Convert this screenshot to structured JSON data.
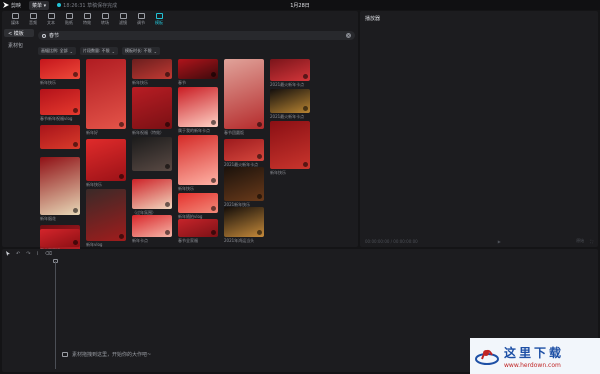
{
  "titlebar": {
    "app_name": "剪映",
    "menu_label": "菜单",
    "draft_info": "18:26:31 草稿保存完成",
    "project_title": "1月28日"
  },
  "toolbar": {
    "items": [
      {
        "label": "媒体",
        "icon": "media-icon"
      },
      {
        "label": "音频",
        "icon": "audio-icon"
      },
      {
        "label": "文本",
        "icon": "text-icon"
      },
      {
        "label": "贴纸",
        "icon": "sticker-icon"
      },
      {
        "label": "特效",
        "icon": "effects-icon"
      },
      {
        "label": "转场",
        "icon": "transition-icon"
      },
      {
        "label": "滤镜",
        "icon": "filter-icon"
      },
      {
        "label": "调节",
        "icon": "adjust-icon"
      },
      {
        "label": "模板",
        "icon": "template-icon"
      }
    ],
    "active_index": 8
  },
  "sidebar": {
    "items": [
      {
        "label": "< 模板"
      },
      {
        "label": "素材包"
      }
    ]
  },
  "search": {
    "value": "春节",
    "clear_icon": "clear-icon"
  },
  "filters": [
    {
      "label": "画幅比例: 全部"
    },
    {
      "label": "片段数量: 不限"
    },
    {
      "label": "模板时长: 不限"
    }
  ],
  "templates": [
    {
      "title": "新年快乐",
      "badge": "",
      "colors": [
        "#c4161c",
        "#f04a3a"
      ]
    },
    {
      "title": "春节新年祝福vlog",
      "badge": "",
      "colors": [
        "#b3121a",
        "#e63a2e"
      ]
    },
    {
      "title": "",
      "badge": "",
      "colors": [
        "#a8141a",
        "#d93b2b"
      ]
    },
    {
      "title": "新年烟花",
      "badge": "",
      "colors": [
        "#8f1015",
        "#e8d9b8"
      ]
    },
    {
      "title": "新年家人福",
      "badge": "",
      "colors": [
        "#6f0d12",
        "#c9232a"
      ]
    },
    {
      "title": "春节团圆饭",
      "badge": "",
      "colors": [
        "#d4252b",
        "#8c0f14"
      ]
    },
    {
      "title": "新年好",
      "badge": "",
      "colors": [
        "#b01c22",
        "#e45449"
      ]
    },
    {
      "title": "新年快乐",
      "badge": "",
      "colors": [
        "#e02b2b",
        "#9c1217"
      ]
    },
    {
      "title": "新年vlog",
      "badge": "",
      "colors": [
        "#3a2a28",
        "#a01c1c"
      ]
    },
    {
      "title": "新年快乐",
      "badge": "",
      "colors": [
        "#6b1e1e",
        "#c23a33"
      ]
    },
    {
      "title": "新年祝福（特效）",
      "badge": "",
      "colors": [
        "#b81d24",
        "#7a1014"
      ]
    },
    {
      "title": "",
      "badge": "",
      "colors": [
        "#1b1b1b",
        "#5a4a44"
      ]
    },
    {
      "title": "（过年氛围）",
      "badge": "",
      "colors": [
        "#cd2127",
        "#f2d8c0"
      ]
    },
    {
      "title": "新年卡点",
      "badge": "",
      "colors": [
        "#d9262a",
        "#f5b6a8"
      ]
    },
    {
      "title": "春节",
      "badge": "",
      "colors": [
        "#b0141b",
        "#3e0a0c"
      ]
    },
    {
      "title": "属于我的新年卡点",
      "badge": "",
      "colors": [
        "#c91c23",
        "#ffd2c6"
      ]
    },
    {
      "title": "新年快乐",
      "badge": "",
      "colors": [
        "#d42a27",
        "#ffb3a6"
      ]
    },
    {
      "title": "新年随拍vlog",
      "badge": "",
      "colors": [
        "#e5322e",
        "#f28a7a"
      ]
    },
    {
      "title": "春节全家福",
      "badge": "",
      "colors": [
        "#c6242a",
        "#7c1116"
      ]
    },
    {
      "title": "春节团圆饭",
      "badge": "",
      "colors": [
        "#e0a39a",
        "#b52b2c"
      ]
    },
    {
      "title": "2021最火新年卡点",
      "badge": "",
      "colors": [
        "#9c1a1d",
        "#d5473d"
      ]
    },
    {
      "title": "2021新年快乐",
      "badge": "",
      "colors": [
        "#1b120c",
        "#6a3a1a"
      ]
    },
    {
      "title": "2021年鸿运当头",
      "badge": "",
      "colors": [
        "#140e0a",
        "#c58a3a"
      ]
    },
    {
      "title": "2021最火新年卡点",
      "badge": "",
      "colors": [
        "#7a141a",
        "#d4363a"
      ]
    },
    {
      "title": "2021最火新年卡点",
      "badge": "",
      "colors": [
        "#130f0d",
        "#b98532"
      ]
    },
    {
      "title": "新年快乐",
      "badge": "",
      "colors": [
        "#8a0f14",
        "#c9352d"
      ]
    }
  ],
  "player": {
    "title": "播放器",
    "time": "00:00:00:00 / 00:00:00:00",
    "ratio": "原始",
    "fullscreen_icon": "fullscreen-icon"
  },
  "timeline": {
    "tip": "素材拖拽到这里，开始你的大作吧~"
  },
  "watermark": {
    "text_cn": "这里下载",
    "url": "www.herdown.com"
  },
  "colors": {
    "accent": "#22c3d6",
    "panel": "#1c1c1f",
    "background": "#141416"
  }
}
